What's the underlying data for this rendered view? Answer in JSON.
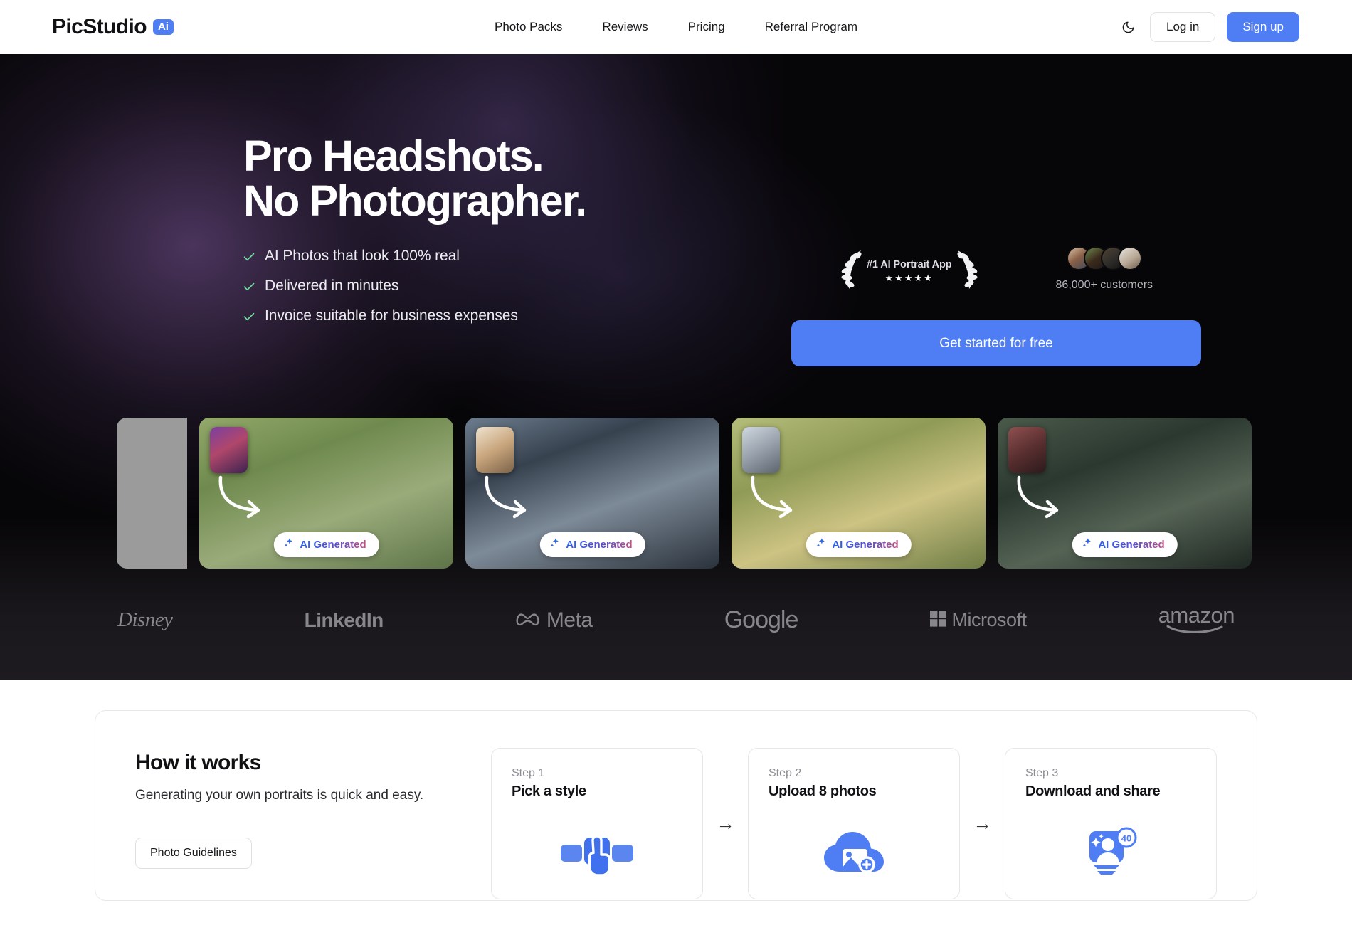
{
  "header": {
    "logo_text": "PicStudio",
    "logo_badge": "Ai",
    "nav": [
      {
        "label": "Photo Packs"
      },
      {
        "label": "Reviews"
      },
      {
        "label": "Pricing"
      },
      {
        "label": "Referral Program"
      }
    ],
    "theme_toggle_icon": "moon-icon",
    "login_label": "Log in",
    "signup_label": "Sign up"
  },
  "hero": {
    "headline_line1": "Pro Headshots.",
    "headline_line2": "No Photographer.",
    "bullets": [
      "AI Photos that look 100% real",
      "Delivered in minutes",
      "Invoice suitable for business expenses"
    ],
    "award": {
      "title": "#1 AI Portrait App",
      "stars": "★★★★★",
      "left_icon": "laurel-left-icon",
      "right_icon": "laurel-right-icon"
    },
    "customers": {
      "count_label": "86,000+ customers",
      "avatar_count": 4
    },
    "cta_label": "Get started for free",
    "gallery": [
      {
        "badge": "AI Generated"
      },
      {
        "badge": "AI Generated"
      },
      {
        "badge": "AI Generated"
      },
      {
        "badge": "AI Generated"
      }
    ],
    "brands": [
      {
        "name": "Disney"
      },
      {
        "name": "LinkedIn"
      },
      {
        "name": "Meta"
      },
      {
        "name": "Google"
      },
      {
        "name": "Microsoft"
      },
      {
        "name": "amazon"
      }
    ]
  },
  "how_it_works": {
    "title": "How it works",
    "subtitle": "Generating your own portraits is quick and easy.",
    "guidelines_label": "Photo Guidelines",
    "separator": "→",
    "steps": [
      {
        "num": "Step 1",
        "title": "Pick a style",
        "icon": "pick-style-icon"
      },
      {
        "num": "Step 2",
        "title": "Upload 8 photos",
        "icon": "cloud-upload-icon"
      },
      {
        "num": "Step 3",
        "title": "Download and share",
        "icon": "download-share-icon",
        "badge": "40"
      }
    ]
  },
  "colors": {
    "accent": "#4f7df3",
    "hero_bg": "#060507",
    "check": "#6ee7a0"
  }
}
